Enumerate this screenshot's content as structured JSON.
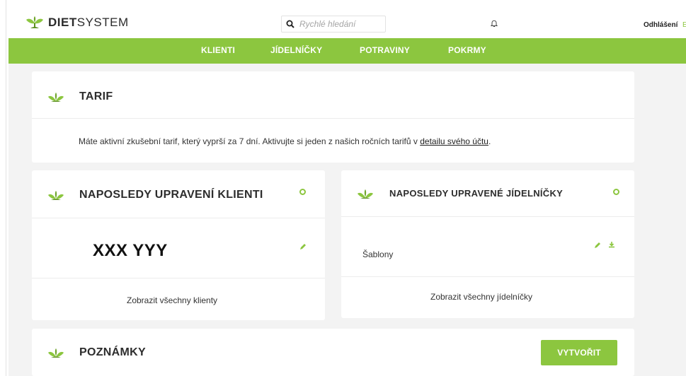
{
  "header": {
    "logo_bold": "DIET",
    "logo_light": "SYSTEM",
    "search_placeholder": "Rychlé hledání",
    "logout_label": "Odhlášení",
    "logout_suffix": "E"
  },
  "nav": {
    "items": [
      {
        "label": "KLIENTI"
      },
      {
        "label": "JÍDELNÍČKY"
      },
      {
        "label": "POTRAVINY"
      },
      {
        "label": "POKRMY"
      }
    ]
  },
  "tarif": {
    "title": "TARIF",
    "text": "Máte aktivní zkušební tarif, který vyprší za 7 dní. Aktivujte si jeden z našich ročních tarifů v",
    "link": "detailu svého účtu",
    "text_end": "."
  },
  "clients": {
    "title": "NAPOSLEDY UPRAVENÍ KLIENTI",
    "client_name": "XXX YYY",
    "footer_link": "Zobrazit všechny klienty"
  },
  "menus": {
    "title": "NAPOSLEDY UPRAVENÉ JÍDELNÍČKY",
    "item": "Šablony",
    "footer_link": "Zobrazit všechny jídelníčky"
  },
  "notes": {
    "title": "POZNÁMKY",
    "create_label": "VYTVOŘIT"
  },
  "colors": {
    "accent": "#8cc63f",
    "background": "#f3f3f3"
  }
}
